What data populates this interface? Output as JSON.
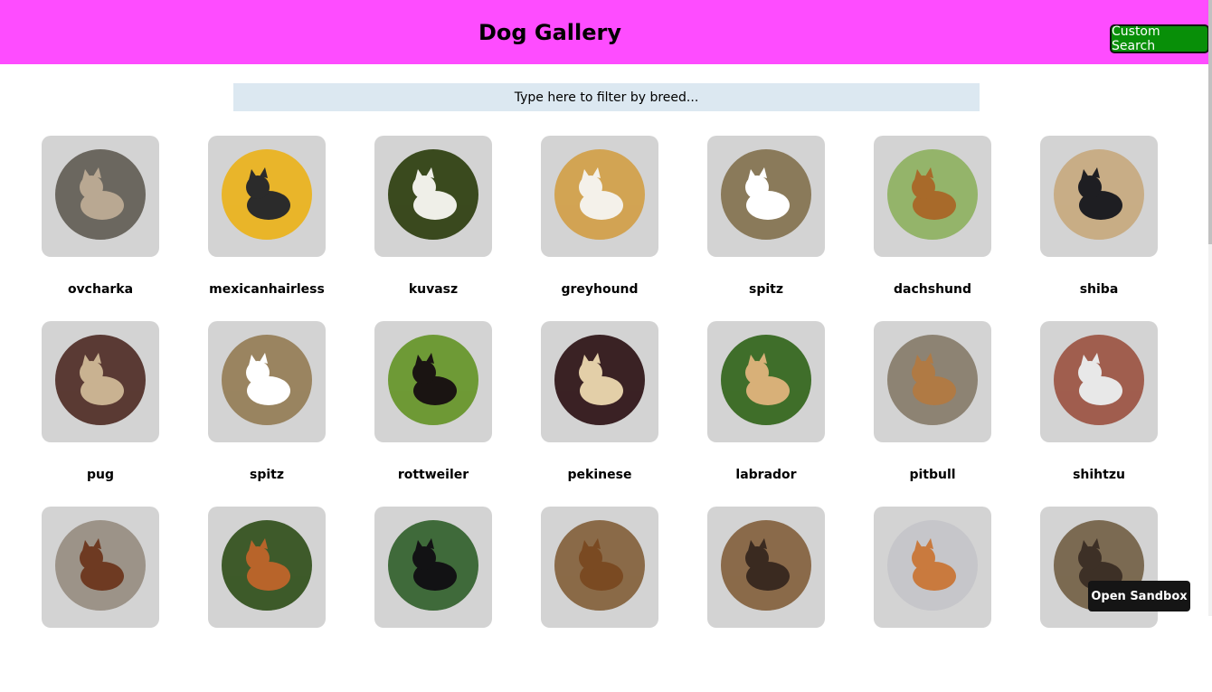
{
  "header": {
    "title": "Dog Gallery",
    "custom_search_label": "Custom Search",
    "background": "#fe4cff"
  },
  "filter": {
    "placeholder": "Type here to filter by breed...",
    "value": ""
  },
  "sandbox_label": "Open Sandbox",
  "dogs": [
    {
      "breed": "ovcharka",
      "bg": "#6b675f",
      "fg": "#b9a892"
    },
    {
      "breed": "mexicanhairless",
      "bg": "#e9b52a",
      "fg": "#2b2b2b"
    },
    {
      "breed": "kuvasz",
      "bg": "#3a4a1e",
      "fg": "#efefe8"
    },
    {
      "breed": "greyhound",
      "bg": "#d2a453",
      "fg": "#f4f1ea"
    },
    {
      "breed": "spitz",
      "bg": "#8a7a5a",
      "fg": "#ffffff"
    },
    {
      "breed": "dachshund",
      "bg": "#94b46a",
      "fg": "#a86a2a"
    },
    {
      "breed": "shiba",
      "bg": "#c8ad86",
      "fg": "#1e1e22"
    },
    {
      "breed": "pug",
      "bg": "#5a3a34",
      "fg": "#c9b291"
    },
    {
      "breed": "spitz",
      "bg": "#9a8460",
      "fg": "#ffffff"
    },
    {
      "breed": "rottweiler",
      "bg": "#6e9a36",
      "fg": "#1a1412"
    },
    {
      "breed": "pekinese",
      "bg": "#3a2224",
      "fg": "#e3cfa8"
    },
    {
      "breed": "labrador",
      "bg": "#3f6e2a",
      "fg": "#d8b078"
    },
    {
      "breed": "pitbull",
      "bg": "#8d8373",
      "fg": "#b07a44"
    },
    {
      "breed": "shihtzu",
      "bg": "#a05e4e",
      "fg": "#e8e8e8"
    },
    {
      "breed": "",
      "bg": "#9c9388",
      "fg": "#6e3a22"
    },
    {
      "breed": "",
      "bg": "#3e5a2a",
      "fg": "#b8642a"
    },
    {
      "breed": "",
      "bg": "#3f6a3a",
      "fg": "#121214"
    },
    {
      "breed": "",
      "bg": "#8a6a48",
      "fg": "#7a4a22"
    },
    {
      "breed": "",
      "bg": "#8a6a4a",
      "fg": "#3a2a20"
    },
    {
      "breed": "",
      "bg": "#c6c6ca",
      "fg": "#c97a3e"
    },
    {
      "breed": "",
      "bg": "#7b6a52",
      "fg": "#3d3026"
    }
  ]
}
